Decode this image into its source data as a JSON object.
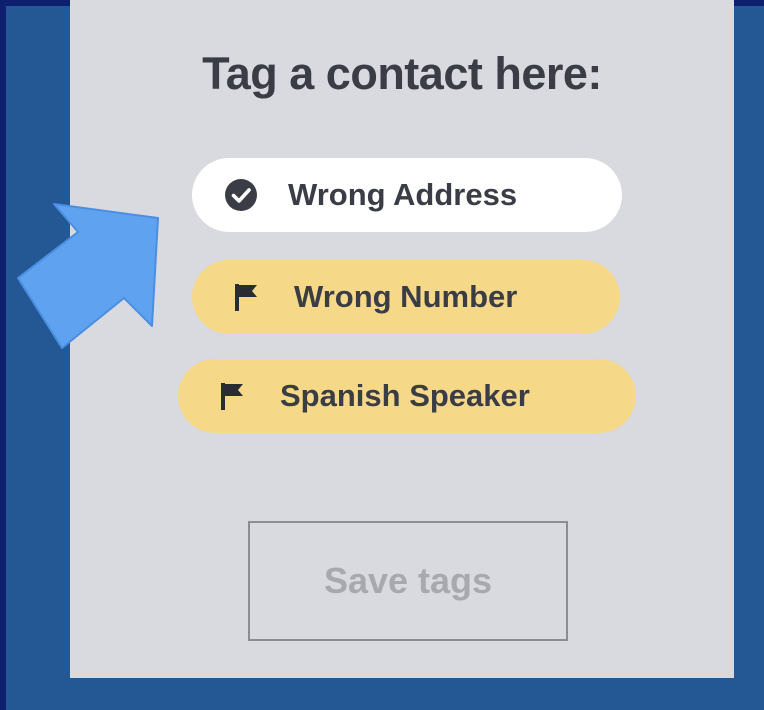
{
  "panel": {
    "title": "Tag a contact here:",
    "tags": [
      {
        "label": "Wrong Address",
        "icon": "check-circle-icon",
        "selected": true,
        "color": "#ffffff"
      },
      {
        "label": "Wrong Number",
        "icon": "flag-icon",
        "selected": false,
        "color": "#f5d888"
      },
      {
        "label": "Spanish Speaker",
        "icon": "flag-icon",
        "selected": false,
        "color": "#f5d888"
      }
    ],
    "save_label": "Save tags"
  },
  "colors": {
    "border": "#0e1f70",
    "background": "#245894",
    "panel": "#d9d9e0",
    "tag_yellow": "#f5d888",
    "arrow": "#5fa3f0",
    "text": "#3a3d45"
  }
}
